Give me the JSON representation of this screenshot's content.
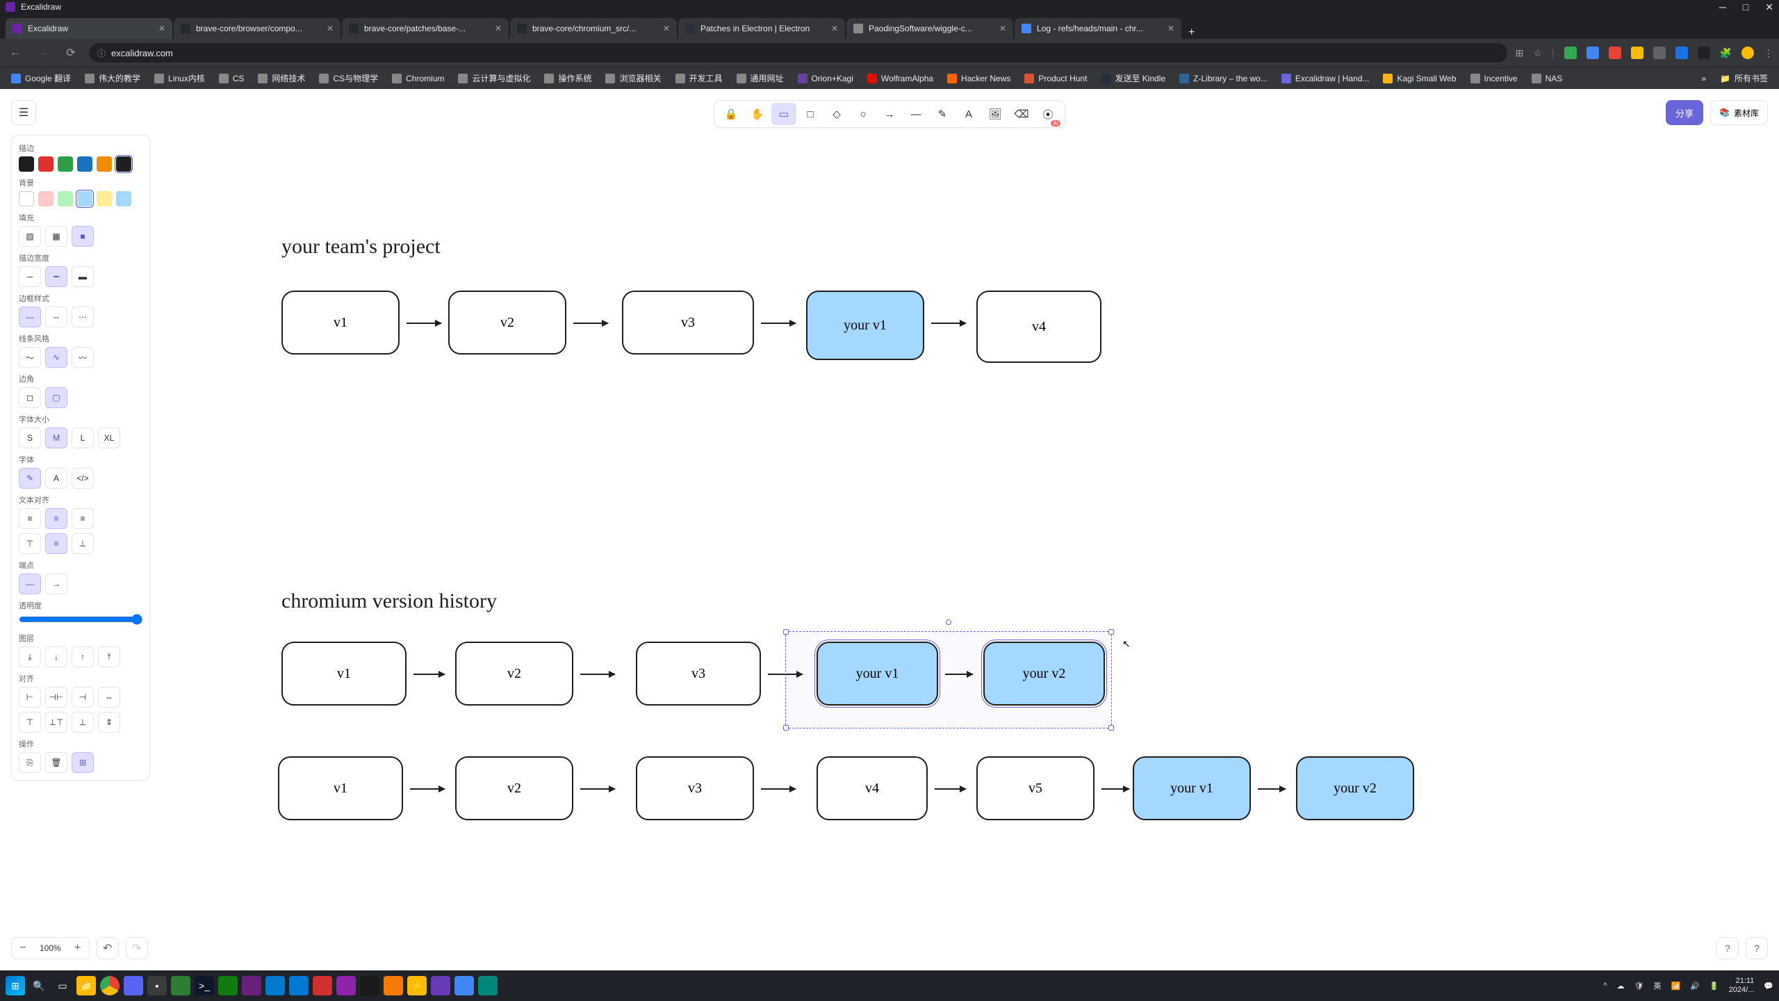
{
  "window": {
    "title": "Excalidraw"
  },
  "tabs": [
    {
      "title": "Excalidraw",
      "favicon": "#6b21a8",
      "active": true
    },
    {
      "title": "brave-core/browser/compo...",
      "favicon": "#24292e"
    },
    {
      "title": "brave-core/patches/base-...",
      "favicon": "#24292e"
    },
    {
      "title": "brave-core/chromium_src/...",
      "favicon": "#24292e"
    },
    {
      "title": "Patches in Electron | Electron",
      "favicon": "#2b2e3b"
    },
    {
      "title": "PaodingSoftware/wiggle-c...",
      "favicon": "#888"
    },
    {
      "title": "Log - refs/heads/main - chr...",
      "favicon": "#4285f4"
    }
  ],
  "url": "excalidraw.com",
  "bookmarks": [
    {
      "label": "Google 翻译",
      "color": "#4285f4"
    },
    {
      "label": "伟大的教学",
      "color": "#888"
    },
    {
      "label": "Linux内核",
      "color": "#888"
    },
    {
      "label": "CS",
      "color": "#888"
    },
    {
      "label": "网络技术",
      "color": "#888"
    },
    {
      "label": "CS与物理学",
      "color": "#888"
    },
    {
      "label": "Chromium",
      "color": "#888"
    },
    {
      "label": "云计算与虚拟化",
      "color": "#888"
    },
    {
      "label": "操作系统",
      "color": "#888"
    },
    {
      "label": "浏览器相关",
      "color": "#888"
    },
    {
      "label": "开发工具",
      "color": "#888"
    },
    {
      "label": "通用网址",
      "color": "#888"
    },
    {
      "label": "Orion+Kagi",
      "color": "#6b3fa0"
    },
    {
      "label": "WolframAlpha",
      "color": "#dd1100"
    },
    {
      "label": "Hacker News",
      "color": "#ff6600"
    },
    {
      "label": "Product Hunt",
      "color": "#da552f"
    },
    {
      "label": "发送至 Kindle",
      "color": "#232f3e"
    },
    {
      "label": "Z-Library – the wo...",
      "color": "#2a6496"
    },
    {
      "label": "Excalidraw | Hand...",
      "color": "#6965db"
    },
    {
      "label": "Kagi Small Web",
      "color": "#ffb319"
    },
    {
      "label": "Incentive",
      "color": "#888"
    },
    {
      "label": "NAS",
      "color": "#888"
    }
  ],
  "bookmarks_overflow": "»",
  "bookmarks_all": "所有书签",
  "toolbar": {
    "share": "分享",
    "library": "素材库"
  },
  "panel": {
    "stroke": "描边",
    "background": "背景",
    "fill": "填充",
    "strokeWidth": "描边宽度",
    "strokeStyle": "边框样式",
    "sloppiness": "线条风格",
    "edges": "边角",
    "fontSize": "字体大小",
    "fontFamily": "字体",
    "textAlign": "文本对齐",
    "verticalAlign": "端点",
    "opacity": "透明度",
    "layers": "图层",
    "align": "对齐",
    "actions": "操作",
    "sizes": {
      "s": "S",
      "m": "M",
      "l": "L",
      "xl": "XL"
    }
  },
  "zoom": {
    "value": "100%"
  },
  "canvas": {
    "heading1": "your team's project",
    "heading2": "chromium version history",
    "row1": [
      "v1",
      "v2",
      "v3",
      "your v1",
      "v4"
    ],
    "row2": [
      "v1",
      "v2",
      "v3",
      "your v1",
      "your v2"
    ],
    "row3": [
      "v1",
      "v2",
      "v3",
      "v4",
      "v5",
      "your v1",
      "your v2"
    ]
  },
  "tray": {
    "ime": "英",
    "time": "21:11",
    "date": "2024/... "
  },
  "colors": {
    "stroke": [
      "#1e1e1e",
      "#e03131",
      "#2f9e44",
      "#1971c2",
      "#f08c00",
      "#000000"
    ],
    "bg": [
      "#ffffff",
      "#ffc9c9",
      "#b2f2bb",
      "#a5d8ff",
      "#ffec99",
      "#a5d8ff"
    ]
  }
}
